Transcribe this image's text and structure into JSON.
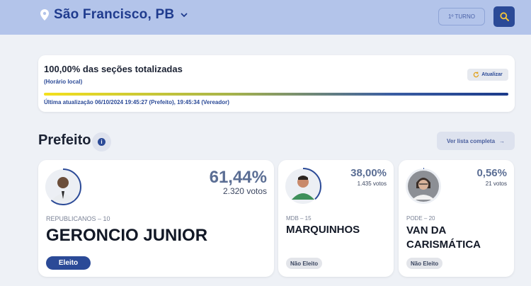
{
  "header": {
    "city": "São Francisco, PB",
    "turno_label": "1º TURNO",
    "colors": {
      "bar_bg": "#b3c4ea",
      "accent": "#2b4a97"
    }
  },
  "status": {
    "title": "100,00% das seções totalizadas",
    "subtitle": "(Horário local)",
    "refresh_label": "Atualizar",
    "progress_percent": 100,
    "updated": "Última atualização 06/10/2024 19:45:27 (Prefeito), 19:45:34 (Vereador)"
  },
  "section": {
    "title": "Prefeito",
    "info_icon": "i",
    "full_list_label": "Ver lista completa",
    "full_list_arrow": "→"
  },
  "candidates": [
    {
      "party": "REPUBLICANOS – 10",
      "name": "GERONCIO JUNIOR",
      "percent": "61,44%",
      "percent_value": 61.44,
      "votes": "2.320 votos",
      "status": "Eleito"
    },
    {
      "party": "MDB – 15",
      "name": "MARQUINHOS",
      "percent": "38,00%",
      "percent_value": 38.0,
      "votes": "1.435 votos",
      "status": "Não Eleito"
    },
    {
      "party": "PODE – 20",
      "name": "VAN DA CARISMÁTICA",
      "percent": "0,56%",
      "percent_value": 0.56,
      "votes": "21 votos",
      "status": "Não Eleito"
    }
  ]
}
